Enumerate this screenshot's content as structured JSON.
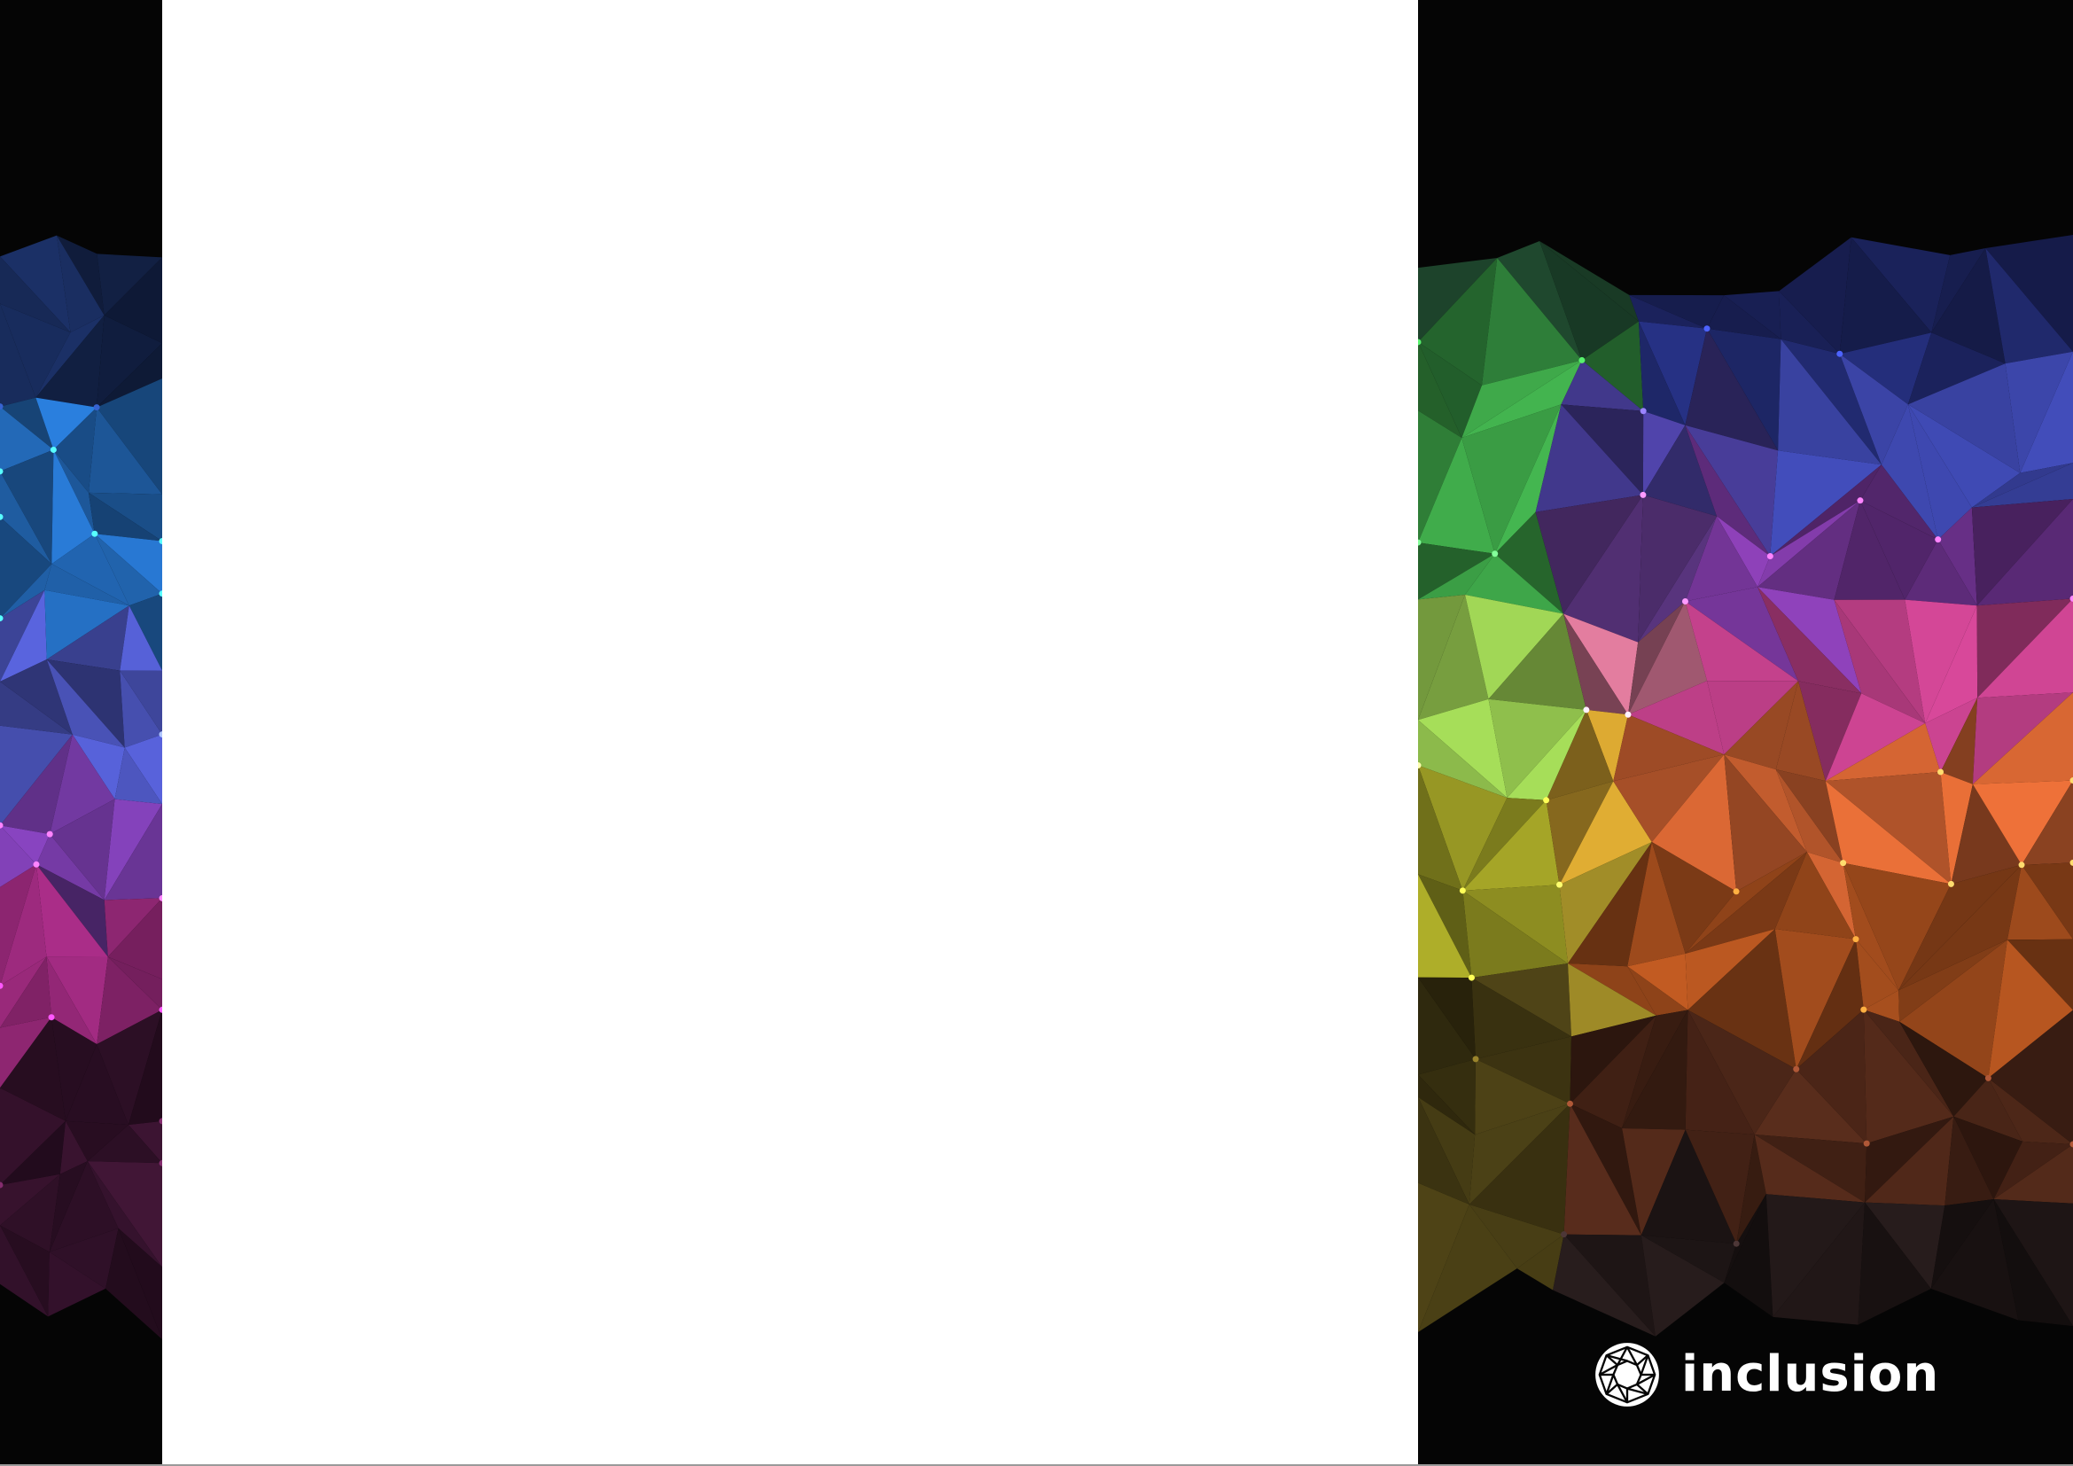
{
  "brand": {
    "logo_icon": "diamond-facet-icon",
    "wordmark": "inclusion"
  },
  "colors": {
    "background": "#050505",
    "page": "#ffffff",
    "wordmark": "#ffffff"
  }
}
